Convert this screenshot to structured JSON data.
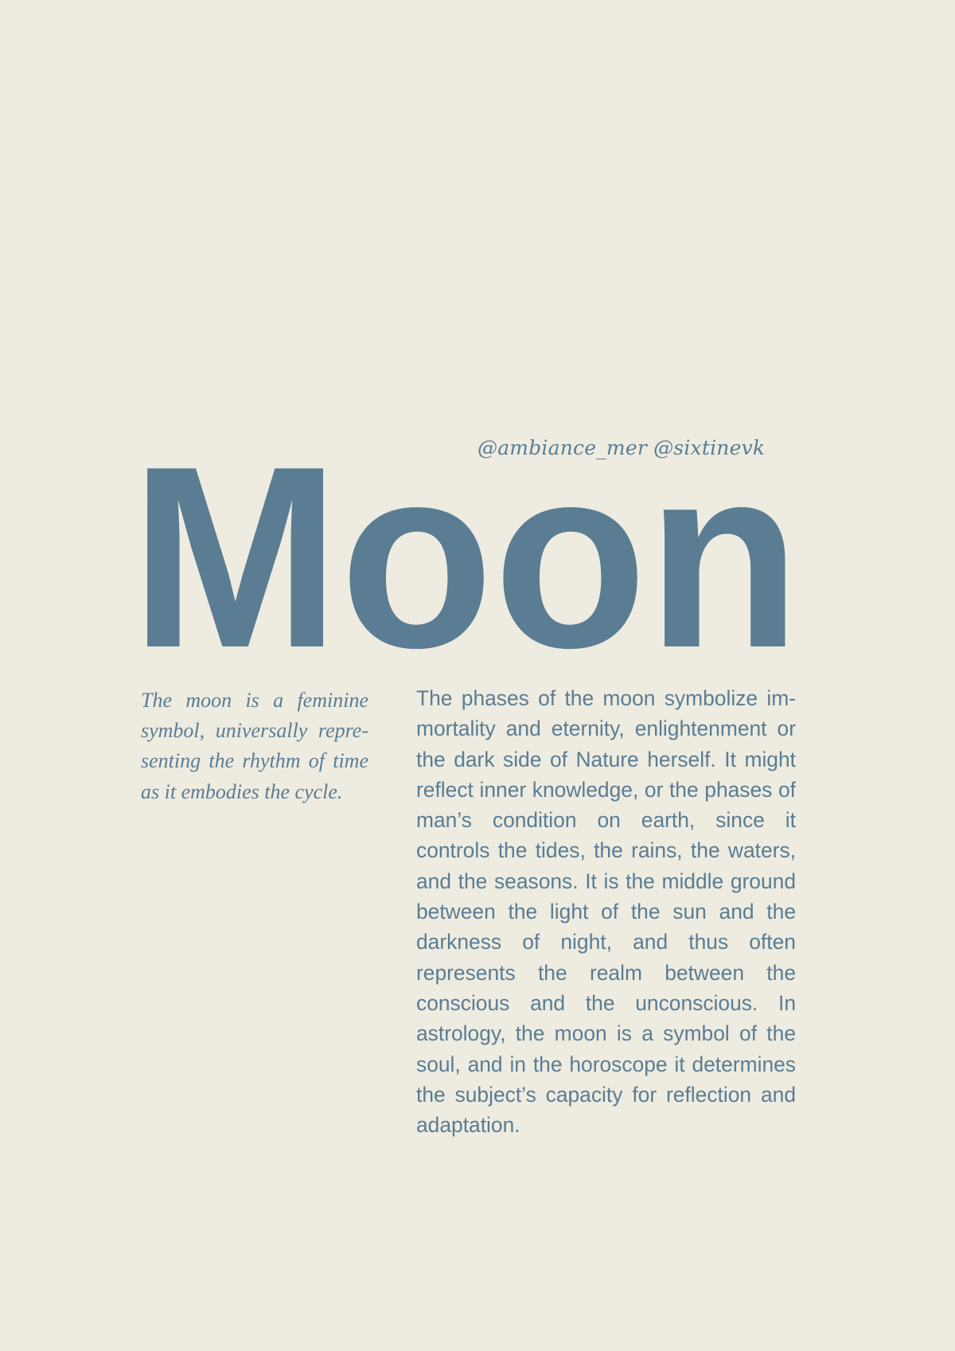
{
  "credits": "@ambiance_mer @sixtinevk",
  "title": "Moon",
  "lede": "The moon is a feminine symbol, universally repre­senting the rhythm of time as it embodies the cycle.",
  "body": "The phases of the moon symbolize im­mortality and eternity, enlightenment or the dark side of Nature herself. It might reflect inner knowledge, or the phases of man’s condition on earth, since it controls the tides, the rains, the wa­ters, and the seasons. It is the middle ground between the light of the sun and the darkness of night, and thus often represents the realm between the conscious and the unconscious. In astrology, the moon is a symbol of the soul, and in the horoscope it deter­mines the subject’s capacity for reflec­tion and adaptation.",
  "colors": {
    "background": "#eeebe0",
    "accent": "#5a7d93"
  }
}
